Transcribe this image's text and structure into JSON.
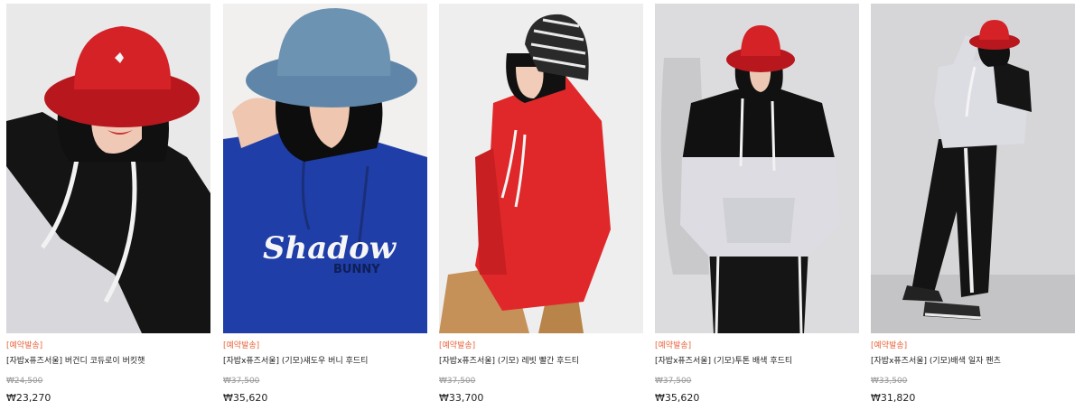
{
  "products": [
    {
      "badge": "[예약발송]",
      "name": "[자밥x퓨즈서울] 버건디 코듀로이 버킷햇",
      "original_price": "₩24,500",
      "sale_price": "₩23,270"
    },
    {
      "badge": "[예약발송]",
      "name": "[자밥x퓨즈서울] (기모)섀도우 버니 후드티",
      "original_price": "₩37,500",
      "sale_price": "₩35,620",
      "print_text": "Shadow",
      "print_subtext": "BUNNY"
    },
    {
      "badge": "[예약발송]",
      "name": "[자밥x퓨즈서울] (기모) 레빗 빨간 후드티",
      "original_price": "₩37,500",
      "sale_price": "₩33,700"
    },
    {
      "badge": "[예약발송]",
      "name": "[자밥x퓨즈서울] (기모)투톤 배색 후드티",
      "original_price": "₩37,500",
      "sale_price": "₩35,620"
    },
    {
      "badge": "[예약발송]",
      "name": "[자밥x퓨즈서울] (기모)배색 일자 팬츠",
      "original_price": "₩33,500",
      "sale_price": "₩31,820"
    }
  ],
  "colors": {
    "badge": "#e8643c",
    "original_price": "#999999",
    "text": "#222222"
  }
}
